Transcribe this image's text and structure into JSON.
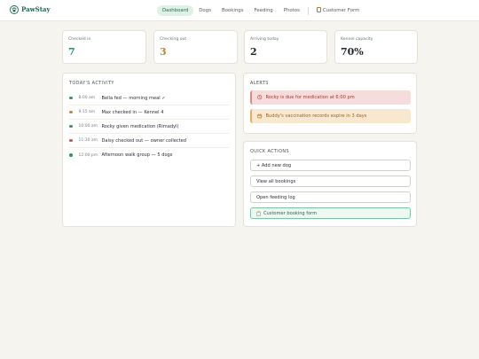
{
  "app": {
    "name": "PawStay"
  },
  "nav": {
    "items": [
      {
        "label": "Dashboard",
        "active": true
      },
      {
        "label": "Dogs"
      },
      {
        "label": "Bookings"
      },
      {
        "label": "Feeding"
      },
      {
        "label": "Photos"
      }
    ],
    "customer_form": {
      "label": "Customer Form",
      "icon": "clipboard-icon"
    }
  },
  "stats": [
    {
      "label": "Checked in",
      "value": "7",
      "color": "#2e8b62"
    },
    {
      "label": "Checking out",
      "value": "3",
      "color": "#b8862b"
    },
    {
      "label": "Arriving today",
      "value": "2",
      "color": "#1d2226"
    },
    {
      "label": "Kennel capacity",
      "value": "70%",
      "color": "#1d2226"
    }
  ],
  "activity": {
    "title": "TODAY'S ACTIVITY",
    "rows": [
      {
        "time": "8:00 am",
        "text": "Bella fed — morning meal ✓",
        "color": "#2e9a6a"
      },
      {
        "time": "9:15 am",
        "text": "Max checked in — Kennel 4",
        "color": "#d9802e"
      },
      {
        "time": "10:00 am",
        "text": "Rocky given medication (Rimadyl)",
        "color": "#2e9a6a"
      },
      {
        "time": "11:30 am",
        "text": "Daisy checked out — owner collected",
        "color": "#d9534f"
      },
      {
        "time": "12:00 pm",
        "text": "Afternoon walk group — 5 dogs",
        "color": "#2e9a6a"
      }
    ]
  },
  "alerts": {
    "title": "ALERTS",
    "items": [
      {
        "text": "Rocky is due for medication at 6:00 pm",
        "type": "danger",
        "icon": "clock-icon"
      },
      {
        "text": "Buddy's vaccination records expire in 3 days",
        "type": "warning",
        "icon": "calendar-icon"
      }
    ]
  },
  "quick_actions": {
    "title": "QUICK ACTIONS",
    "items": [
      {
        "label": "+ Add new dog"
      },
      {
        "label": "View all bookings"
      },
      {
        "label": "Open feeding log"
      },
      {
        "label": "Customer booking form",
        "primary": true,
        "icon": "clipboard-icon"
      }
    ]
  },
  "colors": {
    "brand": "#1f6b4f",
    "accent_bg": "#dff0e7",
    "page_bg": "#f5f4ef"
  }
}
